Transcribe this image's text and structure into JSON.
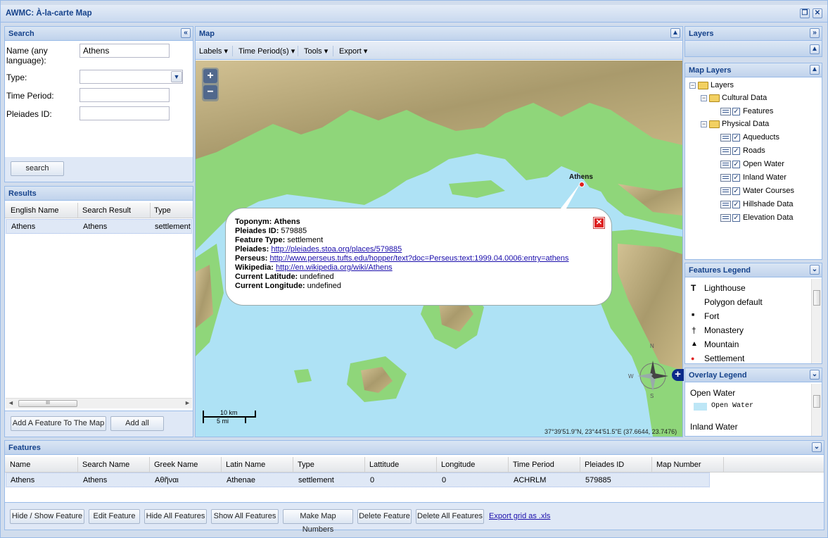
{
  "window": {
    "title": "AWMC: À-la-carte Map"
  },
  "search": {
    "title": "Search",
    "name_label": "Name (any language):",
    "name_value": "Athens",
    "type_label": "Type:",
    "type_value": "",
    "time_label": "Time Period:",
    "time_value": "",
    "pleiades_label": "Pleiades ID:",
    "pleiades_value": "",
    "search_button": "search"
  },
  "results": {
    "title": "Results",
    "columns": [
      "English Name",
      "Search Result",
      "Type"
    ],
    "rows": [
      {
        "english": "Athens",
        "result": "Athens",
        "type": "settlement"
      }
    ],
    "add_feature_button": "Add A Feature To The Map",
    "add_all_button": "Add all",
    "scroll_marker": "III"
  },
  "map": {
    "title": "Map",
    "toolbar": [
      "Labels",
      "Time Period(s)",
      "Tools",
      "Export"
    ],
    "zoom_in": "+",
    "zoom_out": "−",
    "place_label": "Athens",
    "scale_km": "10 km",
    "scale_mi": "5 mi",
    "coords": "37°39'51.9\"N, 23°44'51.5\"E (37.6644, 23.7476)",
    "compass": [
      "N",
      "S",
      "W",
      "E"
    ],
    "popup": {
      "toponym_label": "Toponym:",
      "toponym": "Athens",
      "pleiades_label": "Pleiades ID:",
      "pleiades_id": "579885",
      "ftype_label": "Feature Type:",
      "ftype": "settlement",
      "pleiades_link_label": "Pleiades:",
      "pleiades_link": "http://pleiades.stoa.org/places/579885",
      "perseus_label": "Perseus:",
      "perseus_link": "http://www.perseus.tufts.edu/hopper/text?doc=Perseus:text:1999.04.0006:entry=athens",
      "wiki_label": "Wikipedia:",
      "wiki_link": "http://en.wikipedia.org/wiki/Athens",
      "lat_label": "Current Latitude:",
      "lat": "undefined",
      "lon_label": "Current Longitude:",
      "lon": "undefined"
    }
  },
  "layers": {
    "title": "Layers",
    "map_layers_title": "Map Layers",
    "root": "Layers",
    "cultural": "Cultural Data",
    "cultural_items": [
      "Features"
    ],
    "physical": "Physical Data",
    "physical_items": [
      "Aqueducts",
      "Roads",
      "Open Water",
      "Inland Water",
      "Water Courses",
      "Hillshade Data",
      "Elevation Data"
    ]
  },
  "features_legend": {
    "title": "Features Legend",
    "items": [
      {
        "symbol": "T",
        "label": "Lighthouse"
      },
      {
        "symbol": "",
        "label": "Polygon default"
      },
      {
        "symbol": "■",
        "label": "Fort"
      },
      {
        "symbol": "†",
        "label": "Monastery"
      },
      {
        "symbol": "▲",
        "label": "Mountain"
      },
      {
        "symbol": "●",
        "label": "Settlement"
      }
    ]
  },
  "overlay_legend": {
    "title": "Overlay Legend",
    "open_water": "Open Water",
    "open_water_swatch": "Open Water",
    "inland_water": "Inland Water"
  },
  "features": {
    "title": "Features",
    "columns": [
      "Name",
      "Search Name",
      "Greek Name",
      "Latin Name",
      "Type",
      "Lattitude",
      "Longitude",
      "Time Period",
      "Pleiades ID",
      "Map Number"
    ],
    "rows": [
      {
        "name": "Athens",
        "search": "Athens",
        "greek": "Αθῆναι",
        "latin": "Athenae",
        "type": "settlement",
        "lat": "0",
        "lon": "0",
        "period": "ACHRLM",
        "pleiades": "579885",
        "mapnum": ""
      }
    ],
    "buttons": [
      "Hide / Show Feature",
      "Edit Feature",
      "Hide All Features",
      "Show All Features",
      "Make Map Numbers",
      "Delete Feature",
      "Delete All Features"
    ],
    "export_link": "Export grid as .xls"
  },
  "colors": {
    "header_text": "#15428b",
    "water": "#aee2f5",
    "lowland": "#8fd67a",
    "highland": "#c7b58a"
  }
}
